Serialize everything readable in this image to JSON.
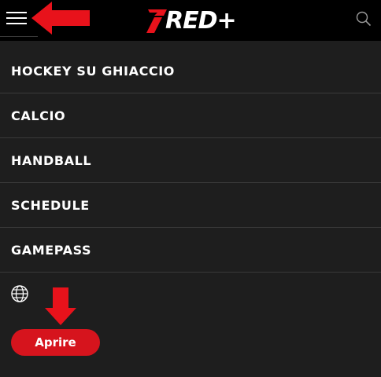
{
  "header": {
    "brand": "RED+",
    "icons": {
      "menu": "hamburger-icon",
      "search": "search-icon",
      "logo_mark": "red-slash-logo"
    }
  },
  "menu": {
    "items": [
      {
        "label": "HOCKEY SU GHIACCIO"
      },
      {
        "label": "CALCIO"
      },
      {
        "label": "HANDBALL"
      },
      {
        "label": "SCHEDULE"
      },
      {
        "label": "GAMEPASS"
      }
    ]
  },
  "language": {
    "icon": "globe-icon"
  },
  "cta": {
    "open_label": "Aprire"
  },
  "annotations": {
    "arrow_color": "#e8121b",
    "arrows": [
      "left-pointing-arrow",
      "down-pointing-arrow"
    ]
  },
  "colors": {
    "header_bg": "#000000",
    "menu_bg": "#1e1e1e",
    "accent": "#d6141d",
    "divider": "#3a3a3a"
  }
}
